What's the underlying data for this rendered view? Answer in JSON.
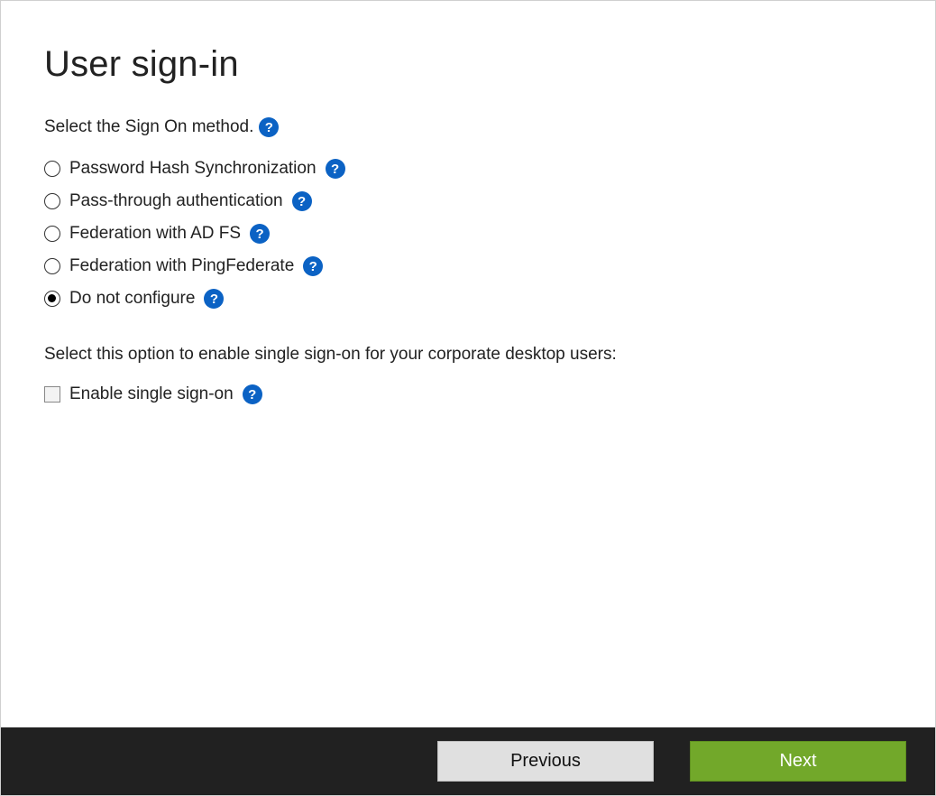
{
  "header": {
    "title": "User sign-in"
  },
  "prompt": {
    "text": "Select the Sign On method.",
    "help_icon": "?"
  },
  "sign_on_options": [
    {
      "label": "Password Hash Synchronization",
      "selected": false,
      "help_icon": "?"
    },
    {
      "label": "Pass-through authentication",
      "selected": false,
      "help_icon": "?"
    },
    {
      "label": "Federation with AD FS",
      "selected": false,
      "help_icon": "?"
    },
    {
      "label": "Federation with PingFederate",
      "selected": false,
      "help_icon": "?"
    },
    {
      "label": "Do not configure",
      "selected": true,
      "help_icon": "?"
    }
  ],
  "sso_section": {
    "description": "Select this option to enable single sign-on for your corporate desktop users:",
    "checkbox_label": "Enable single sign-on",
    "checked": false,
    "help_icon": "?"
  },
  "footer": {
    "previous_label": "Previous",
    "next_label": "Next"
  },
  "colors": {
    "help_icon_bg": "#0b62c4",
    "footer_bg": "#212121",
    "next_btn_bg": "#72a82a",
    "prev_btn_bg": "#e0e0e0"
  }
}
